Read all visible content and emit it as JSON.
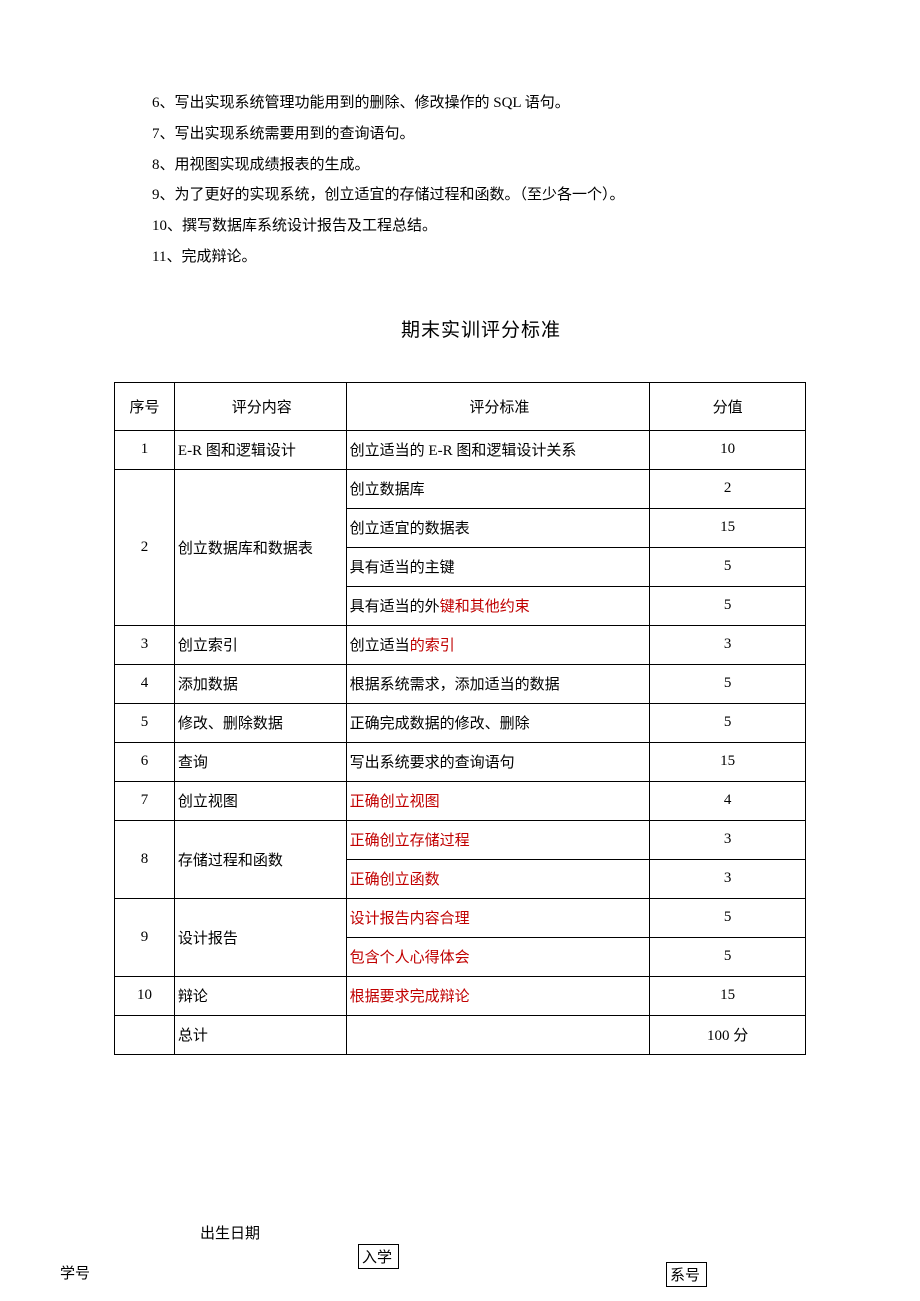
{
  "tasks": [
    "6、写出实现系统管理功能用到的删除、修改操作的 SQL 语句。",
    "7、写出实现系统需要用到的查询语句。",
    "8、用视图实现成绩报表的生成。",
    "9、为了更好的实现系统，创立适宜的存储过程和函数。（至少各一个）。",
    "10、撰写数据库系统设计报告及工程总结。",
    "11、完成辩论。"
  ],
  "section_title": "期末实训评分标准",
  "headers": {
    "seq": "序号",
    "content": "评分内容",
    "standard": "评分标准",
    "score": "分值"
  },
  "rows": [
    {
      "seq": "1",
      "content": "E-R 图和逻辑设计",
      "standards": [
        {
          "t": "创立适当的 E-R 图和逻辑设计关系",
          "s": "10"
        }
      ]
    },
    {
      "seq": "2",
      "content": "创立数据库和数据表",
      "standards": [
        {
          "t": "创立数据库",
          "s": "2"
        },
        {
          "t": "创立适宜的数据表",
          "s": "15"
        },
        {
          "t": "具有适当的主键",
          "s": "5"
        },
        {
          "pre": "具有适当的外",
          "red": "键和其他约束",
          "s": "5"
        }
      ]
    },
    {
      "seq": "3",
      "content": "创立索引",
      "standards": [
        {
          "pre": "创立适当",
          "red": "的索引",
          "s": "3"
        }
      ]
    },
    {
      "seq": "4",
      "content": "添加数据",
      "standards": [
        {
          "t": "根据系统需求，添加适当的数据",
          "s": "5"
        }
      ]
    },
    {
      "seq": "5",
      "content": "修改、删除数据",
      "standards": [
        {
          "t": "正确完成数据的修改、删除",
          "s": "5"
        }
      ]
    },
    {
      "seq": "6",
      "content": "查询",
      "standards": [
        {
          "t": "写出系统要求的查询语句",
          "s": "15"
        }
      ]
    },
    {
      "seq": "7",
      "content": "创立视图",
      "standards": [
        {
          "red": "正确创立视图",
          "s": "4"
        }
      ]
    },
    {
      "seq": "8",
      "content": "存储过程和函数",
      "standards": [
        {
          "red": "正确创立存储过程",
          "s": "3"
        },
        {
          "red": "正确创立函数",
          "s": "3"
        }
      ]
    },
    {
      "seq": "9",
      "content": "设计报告",
      "standards": [
        {
          "red": "设计报告内容合理",
          "s": "5"
        },
        {
          "red": "包含个人心得体会",
          "s": "5"
        }
      ]
    },
    {
      "seq": "10",
      "content": "辩论",
      "standards": [
        {
          "red": "根据要求完成辩论",
          "s": "15"
        }
      ]
    },
    {
      "seq": "",
      "content": "总计",
      "standards": [
        {
          "t": "",
          "s": "100 分"
        }
      ]
    }
  ],
  "footer": {
    "birth": "出生日期",
    "enroll": "入学",
    "student_id": "学号",
    "dept_id": "系号"
  }
}
